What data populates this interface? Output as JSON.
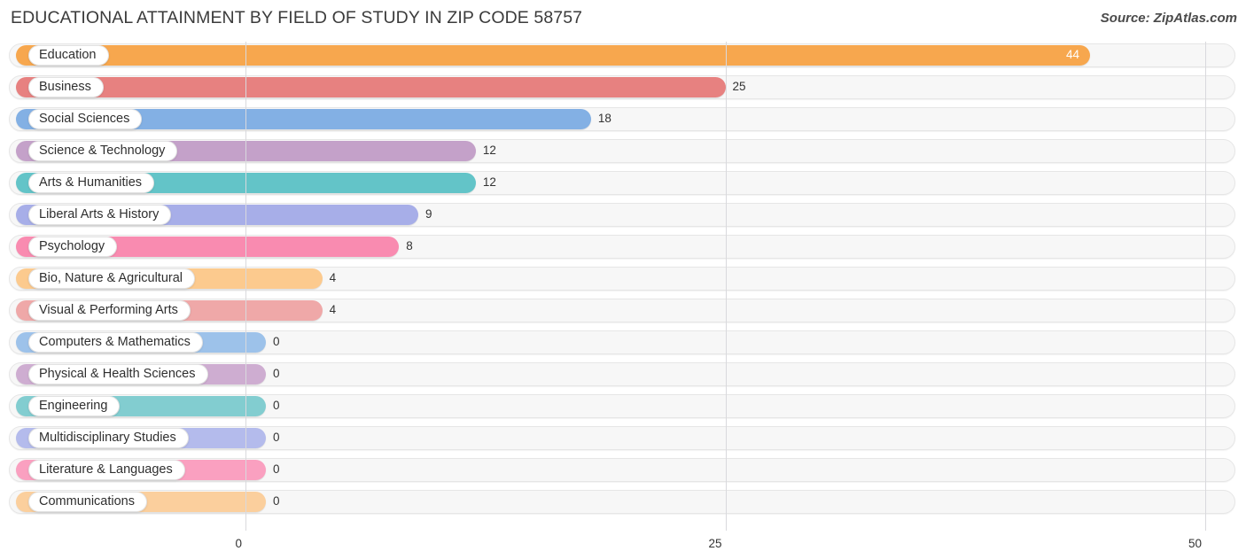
{
  "header": {
    "title": "EDUCATIONAL ATTAINMENT BY FIELD OF STUDY IN ZIP CODE 58757",
    "source": "Source: ZipAtlas.com"
  },
  "chart_data": {
    "type": "bar",
    "orientation": "horizontal",
    "title": "EDUCATIONAL ATTAINMENT BY FIELD OF STUDY IN ZIP CODE 58757",
    "xlabel": "",
    "ylabel": "",
    "xlim": [
      0,
      50
    ],
    "ticks": [
      "0",
      "25",
      "50"
    ],
    "tick_values": [
      0,
      25,
      50
    ],
    "grid": true,
    "legend": false,
    "categories": [
      "Education",
      "Business",
      "Social Sciences",
      "Science & Technology",
      "Arts & Humanities",
      "Liberal Arts & History",
      "Psychology",
      "Bio, Nature & Agricultural",
      "Visual & Performing Arts",
      "Computers & Mathematics",
      "Physical & Health Sciences",
      "Engineering",
      "Multidisciplinary Studies",
      "Literature & Languages",
      "Communications"
    ],
    "values": [
      44,
      25,
      18,
      12,
      12,
      9,
      8,
      4,
      4,
      0,
      0,
      0,
      0,
      0,
      0
    ],
    "value_labels": [
      "44",
      "25",
      "18",
      "12",
      "12",
      "9",
      "8",
      "4",
      "4",
      "0",
      "0",
      "0",
      "0",
      "0",
      "0"
    ],
    "colors": [
      "#f7a74e",
      "#e78180",
      "#83b0e4",
      "#c4a1c9",
      "#63c4c8",
      "#a7aee8",
      "#f98bb0",
      "#fcca8e",
      "#efa8a8",
      "#9dc2ea",
      "#ceadd1",
      "#82cdd0",
      "#b4bbec",
      "#faa0c0",
      "#fbcf9d"
    ],
    "bars": [
      {
        "label": "Education",
        "value": 44,
        "value_label": "44",
        "color": "#f7a74e",
        "label_inside": true
      },
      {
        "label": "Business",
        "value": 25,
        "value_label": "25",
        "color": "#e78180",
        "label_inside": false
      },
      {
        "label": "Social Sciences",
        "value": 18,
        "value_label": "18",
        "color": "#83b0e4",
        "label_inside": false
      },
      {
        "label": "Science & Technology",
        "value": 12,
        "value_label": "12",
        "color": "#c4a1c9",
        "label_inside": false
      },
      {
        "label": "Arts & Humanities",
        "value": 12,
        "value_label": "12",
        "color": "#63c4c8",
        "label_inside": false
      },
      {
        "label": "Liberal Arts & History",
        "value": 9,
        "value_label": "9",
        "color": "#a7aee8",
        "label_inside": false
      },
      {
        "label": "Psychology",
        "value": 8,
        "value_label": "8",
        "color": "#f98bb0",
        "label_inside": false
      },
      {
        "label": "Bio, Nature & Agricultural",
        "value": 4,
        "value_label": "4",
        "color": "#fcca8e",
        "label_inside": false
      },
      {
        "label": "Visual & Performing Arts",
        "value": 4,
        "value_label": "4",
        "color": "#efa8a8",
        "label_inside": false
      },
      {
        "label": "Computers & Mathematics",
        "value": 0,
        "value_label": "0",
        "color": "#9dc2ea",
        "label_inside": false
      },
      {
        "label": "Physical & Health Sciences",
        "value": 0,
        "value_label": "0",
        "color": "#ceadd1",
        "label_inside": false
      },
      {
        "label": "Engineering",
        "value": 0,
        "value_label": "0",
        "color": "#82cdd0",
        "label_inside": false
      },
      {
        "label": "Multidisciplinary Studies",
        "value": 0,
        "value_label": "0",
        "color": "#b4bbec",
        "label_inside": false
      },
      {
        "label": "Literature & Languages",
        "value": 0,
        "value_label": "0",
        "color": "#faa0c0",
        "label_inside": false
      },
      {
        "label": "Communications",
        "value": 0,
        "value_label": "0",
        "color": "#fbcf9d",
        "label_inside": false
      }
    ]
  }
}
